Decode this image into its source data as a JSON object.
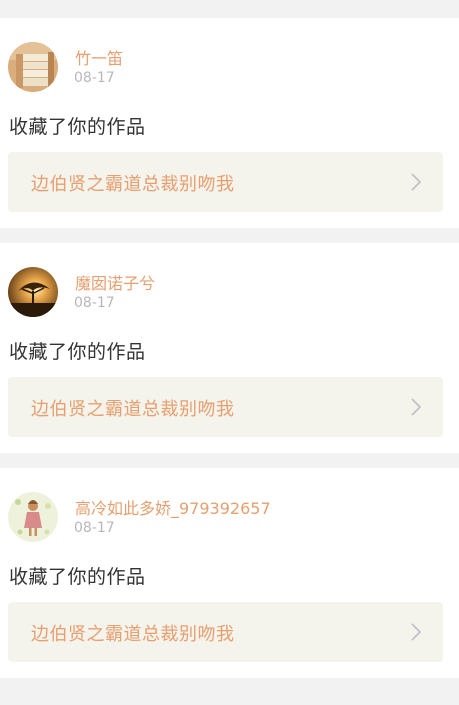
{
  "colors": {
    "accent": "#e89f6f",
    "date": "#b8b8b8",
    "text": "#333333",
    "link_bg": "#f4f3ec",
    "page_bg": "#f2f2f2"
  },
  "notifications": [
    {
      "username": "竹一笛",
      "date": "08-17",
      "action": "收藏了你的作品",
      "work_title": "边伯贤之霸道总裁别吻我",
      "avatar_icon": "books-avatar"
    },
    {
      "username": "魔囡诺子兮",
      "date": "08-17",
      "action": "收藏了你的作品",
      "work_title": "边伯贤之霸道总裁别吻我",
      "avatar_icon": "sunset-tree-avatar"
    },
    {
      "username": "高冷如此多娇_979392657",
      "date": "08-17",
      "action": "收藏了你的作品",
      "work_title": "边伯贤之霸道总裁别吻我",
      "avatar_icon": "girl-illustration-avatar"
    }
  ]
}
